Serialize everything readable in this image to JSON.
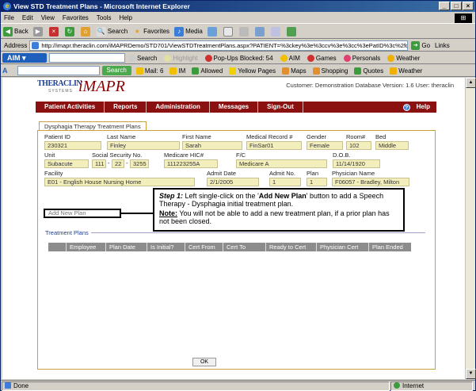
{
  "window": {
    "title": "View STD Treatment Plans - Microsoft Internet Explorer",
    "controls": [
      "_",
      "□",
      "×"
    ]
  },
  "menu": [
    "File",
    "Edit",
    "View",
    "Favorites",
    "Tools",
    "Help"
  ],
  "toolbar": {
    "back": "Back",
    "forward": "",
    "search": "Search",
    "favorites": "Favorites",
    "media": "Media"
  },
  "address": {
    "label": "Address",
    "url": "http://imapr.theraclin.com/iMAPRDemo/STD701/ViewSTDTreatmentPlans.aspx?PATIENT=%3ckey%3e%3ccv%3e%3cc%3ePatID%3c%2fc%3e%3ccv",
    "go": "Go",
    "links": "Links"
  },
  "aim_bar": {
    "logo": "AIM",
    "search": "Search",
    "highlight": "Highlight",
    "popups": "Pop-Ups Blocked: 54",
    "aim": "AIM",
    "games": "Games",
    "personals": "Personals",
    "weather": "Weather"
  },
  "search_bar": {
    "search_btn": "Search",
    "mail": "Mail: 6",
    "im": "IM",
    "allowed": "Allowed",
    "yellow_pages": "Yellow Pages",
    "maps": "Maps",
    "shopping": "Shopping",
    "quotes": "Quotes",
    "weather": "Weather"
  },
  "app": {
    "logo_top": "THERACLIN",
    "logo_sub": "SYSTEMS",
    "logo_big": "iMAPR",
    "customer_line": "Customer: Demonstration Database Version: 1.6 User: theraclin",
    "nav": [
      "Patient Activities",
      "Reports",
      "Administration",
      "Messages",
      "Sign-Out"
    ],
    "help": "Help",
    "tab_title": "Dysphagia Therapy Treatment Plans"
  },
  "patient": {
    "labels": {
      "patient_id": "Patient ID",
      "last_name": "Last Name",
      "first_name": "First Name",
      "medical_record": "Medical Record #",
      "gender": "Gender",
      "room": "Room#",
      "bed": "Bed",
      "unit": "Unit",
      "ssn": "Social Security No.",
      "medicare_hic": "Medicare HIC#",
      "fc": "F/C",
      "dob": "D.O.B.",
      "facility": "Facility",
      "admit_date": "Admit Date",
      "admit_no": "Admit No.",
      "plan": "Plan",
      "physician": "Physician Name"
    },
    "values": {
      "patient_id": "230321",
      "last_name": "Finley",
      "first_name": "Sarah",
      "medical_record": "FinSar01",
      "gender": "Female",
      "room": "102",
      "bed": "Middle",
      "unit": "Subacute",
      "ssn1": "111",
      "ssn2": "22",
      "ssn3": "3255",
      "medicare_hic": "111223255A",
      "fc": "Medicare A",
      "dob": "11/14/1920",
      "facility": "E01 - English House Nursing Home",
      "admit_date": "2/1/2005",
      "admit_no": "1",
      "plan": "1",
      "physician": "F06057 - Bradley, Milton"
    }
  },
  "add_new_plan": "Add New Plan",
  "callout": {
    "step_label": "Step 1:",
    "step_text_pre": " Left single-click on the '",
    "step_target": "Add New Plan",
    "step_text_post": "' button to add a Speech Therapy - Dysphagia initial treatment plan.",
    "note_label": "Note:",
    "note_text": " You will not be able to add a new treatment plan, if a prior plan has not been closed."
  },
  "treatment_plans": {
    "title": "Treatment Plans",
    "columns": [
      "Employee",
      "Plan Date",
      "Is Initial?",
      "Cert From",
      "Cert To",
      "Ready to Cert",
      "Physician Cert",
      "Plan Ended"
    ]
  },
  "ok_button": "OK",
  "status": {
    "left": "Done",
    "zone": "Internet"
  }
}
